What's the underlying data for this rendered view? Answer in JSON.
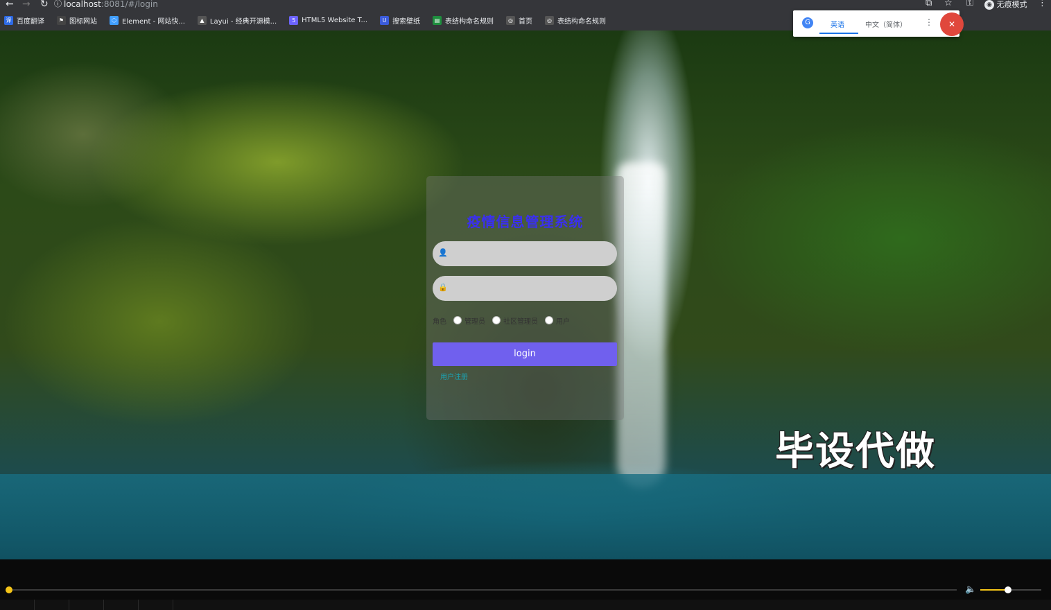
{
  "browser": {
    "url_host": "localhost",
    "url_path": ":8081/#/login",
    "incognito_label": "无痕模式",
    "bookmarks": [
      {
        "label": "百度翻译",
        "icon": "baidu-translate-icon",
        "color": "#2e6ae6"
      },
      {
        "label": "图标网站",
        "icon": "flag-icon",
        "color": "#444444"
      },
      {
        "label": "Element - 网站快...",
        "icon": "element-icon",
        "color": "#409eff"
      },
      {
        "label": "Layui - 经典开源模...",
        "icon": "layui-icon",
        "color": "#555555"
      },
      {
        "label": "HTML5 Website T...",
        "icon": "html5-icon",
        "color": "#6c63ff"
      },
      {
        "label": "搜索壁纸",
        "icon": "wallpaper-icon",
        "color": "#3b5bdb"
      },
      {
        "label": "表结构命名规则",
        "icon": "doc-icon",
        "color": "#1e8e3e"
      },
      {
        "label": "首页",
        "icon": "globe-icon",
        "color": "#555555"
      },
      {
        "label": "表结构命名规则",
        "icon": "globe-icon",
        "color": "#555555"
      }
    ]
  },
  "translate_popup": {
    "tab_source": "英语",
    "tab_target": "中文（简体）"
  },
  "login": {
    "title": "疫情信息管理系统",
    "username_placeholder": "",
    "password_placeholder": "",
    "role_label": "角色",
    "roles": [
      "管理员",
      "社区管理员",
      "用户"
    ],
    "login_button": "login",
    "register_link": "用户注册"
  },
  "watermark": "毕设代做",
  "player": {
    "progress": 0.0,
    "volume": 0.45,
    "accent": "#f5c518"
  },
  "colors": {
    "title": "#3a2ff0",
    "button": "#7060ee",
    "link": "#1aa5b5"
  }
}
